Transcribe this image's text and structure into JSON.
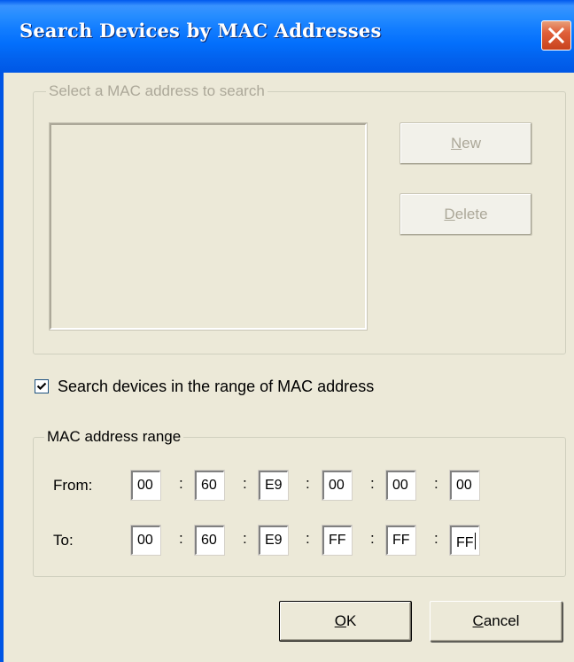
{
  "window": {
    "title": "Search Devices by MAC Addresses",
    "close_icon": "close-icon"
  },
  "select_group": {
    "legend": "Select a MAC address to search",
    "list_items": [],
    "new_button": {
      "mnemonic": "N",
      "rest": "ew",
      "enabled": false
    },
    "delete_button": {
      "mnemonic": "D",
      "rest": "elete",
      "enabled": false
    }
  },
  "range_checkbox": {
    "label": "Search devices in the range of MAC address",
    "checked": true
  },
  "range_group": {
    "legend": "MAC address range",
    "from": {
      "label": "From:",
      "octets": [
        "00",
        "60",
        "E9",
        "00",
        "00",
        "00"
      ]
    },
    "to": {
      "label": "To:",
      "octets": [
        "00",
        "60",
        "E9",
        "FF",
        "FF",
        "FF"
      ]
    },
    "separator": ":"
  },
  "footer": {
    "ok_button": {
      "mnemonic": "O",
      "rest": "K"
    },
    "cancel_button": {
      "mnemonic": "C",
      "rest": "ancel"
    }
  },
  "colors": {
    "titlebar": "#0a5ae8",
    "dialog_bg": "#ece9d8",
    "disabled_text": "#aca899",
    "close_button": "#d9552f"
  }
}
